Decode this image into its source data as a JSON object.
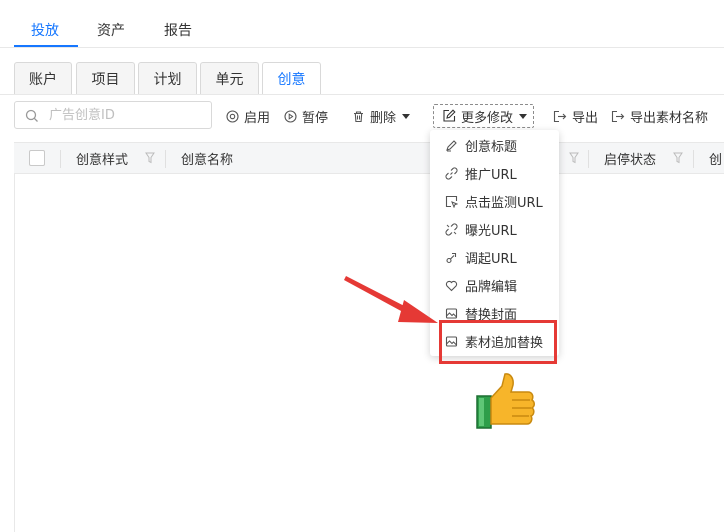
{
  "top_tabs": [
    "投放",
    "资产",
    "报告"
  ],
  "sub_tabs": [
    "账户",
    "项目",
    "计划",
    "单元",
    "创意"
  ],
  "toolbar": {
    "search_placeholder": "广告创意ID",
    "enable": "启用",
    "pause": "暂停",
    "delete": "删除",
    "more_edit": "更多修改",
    "export": "导出",
    "export_material": "导出素材名称"
  },
  "table": {
    "headers": [
      "创意样式",
      "创意名称",
      "启停状态",
      "创"
    ]
  },
  "more_edit_menu": {
    "items": [
      {
        "label": "创意标题",
        "icon": "pen-icon"
      },
      {
        "label": "推广URL",
        "icon": "link-icon"
      },
      {
        "label": "点击监测URL",
        "icon": "click-monitor-icon"
      },
      {
        "label": "曝光URL",
        "icon": "broken-link-icon"
      },
      {
        "label": "调起URL",
        "icon": "invoke-icon"
      },
      {
        "label": "品牌编辑",
        "icon": "heart-badge-icon"
      },
      {
        "label": "替换封面",
        "icon": "image-icon"
      },
      {
        "label": "素材追加替换",
        "icon": "image-icon"
      }
    ],
    "highlighted": "素材追加替换"
  },
  "colors": {
    "accent": "#1677ff",
    "annotation": "#e53935"
  }
}
